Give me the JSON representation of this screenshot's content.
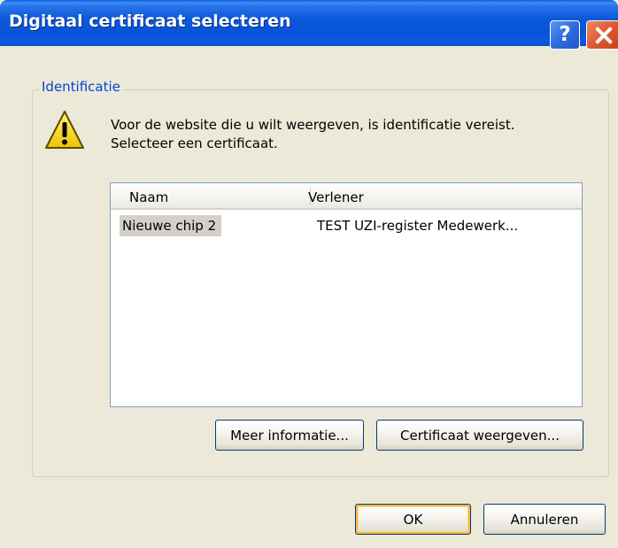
{
  "window": {
    "title": "Digitaal certificaat selecteren",
    "help_glyph": "?",
    "title_color": "#0754d8",
    "close_color": "#e0582f"
  },
  "group": {
    "label": "Identificatie",
    "label_color": "#0046d5"
  },
  "icons": {
    "warning": "warning-triangle-icon",
    "help": "help-icon",
    "close": "close-icon"
  },
  "message": "Voor de website die u wilt weergeven, is identificatie vereist. Selecteer een certificaat.",
  "certificate_list": {
    "columns": [
      "Naam",
      "Verlener"
    ],
    "rows": [
      {
        "naam": "Nieuwe chip 2",
        "verlener": "TEST UZI-register Medewerk..."
      }
    ],
    "selected_row": 0
  },
  "buttons": {
    "meer_informatie": "Meer informatie...",
    "certificaat_weergeven": "Certificaat weergeven...",
    "ok": "OK",
    "annuleren": "Annuleren"
  }
}
